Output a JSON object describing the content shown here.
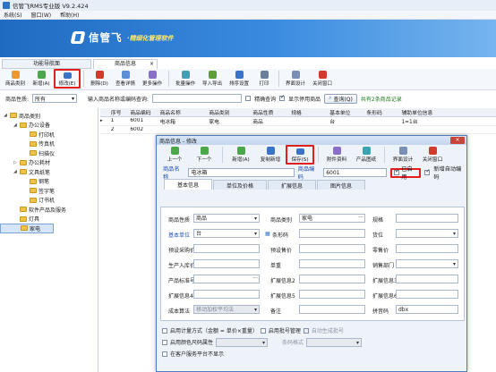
{
  "window": {
    "title": "信管飞RMS专业版 V9.2.424"
  },
  "menu": [
    "系统(S)",
    "窗口(W)",
    "帮助(H)"
  ],
  "banner": {
    "brand": "信管飞",
    "tagline": "·精细化管理软件"
  },
  "tabs": {
    "nav": "功能导航面",
    "doc": "商品信息",
    "doc_close": "×"
  },
  "toolbar": [
    {
      "label": "商品类别",
      "color": "#e99b2b"
    },
    {
      "label": "新增(A)",
      "color": "#4aa84a"
    },
    {
      "label": "修改(E)",
      "color": "#3a74c9"
    },
    {
      "label": "删除(D)",
      "color": "#d23a2a"
    },
    {
      "label": "查看详情",
      "color": "#5b8fd6"
    },
    {
      "label": "更多操作",
      "color": "#8a6fc8"
    },
    {
      "label": "批量操作",
      "color": "#3ca3b5"
    },
    {
      "label": "导入导出",
      "color": "#5e9d3a"
    },
    {
      "label": "排序设置",
      "color": "#3a74c9"
    },
    {
      "label": "打印",
      "color": "#6a7f99"
    },
    {
      "label": "界面设计",
      "color": "#7a8fb5"
    },
    {
      "label": "关闭窗口",
      "color": "#d23a2a"
    }
  ],
  "filter": {
    "prop_label": "商品性质:",
    "prop_value": "所有",
    "search_label": "输入商品名称或编码查询:",
    "exact_label": "精确查询",
    "show_disabled_label": "显示停用商品",
    "query_btn": "查询(Q)",
    "summary": "共有2条商品记录"
  },
  "tree": [
    {
      "label": "商品类别",
      "level": 0,
      "toggle": "◢"
    },
    {
      "label": "办公设备",
      "level": 1,
      "toggle": "◢"
    },
    {
      "label": "打印机",
      "level": 2,
      "toggle": ""
    },
    {
      "label": "传真机",
      "level": 2,
      "toggle": ""
    },
    {
      "label": "扫描仪",
      "level": 2,
      "toggle": ""
    },
    {
      "label": "办公耗材",
      "level": 1,
      "toggle": "▷"
    },
    {
      "label": "文具纸笔",
      "level": 1,
      "toggle": "◢"
    },
    {
      "label": "钢笔",
      "level": 2,
      "toggle": ""
    },
    {
      "label": "签字笔",
      "level": 2,
      "toggle": ""
    },
    {
      "label": "订书机",
      "level": 2,
      "toggle": ""
    },
    {
      "label": "软件产品及服务",
      "level": 1,
      "toggle": ""
    },
    {
      "label": "灯具",
      "level": 1,
      "toggle": ""
    },
    {
      "label": "家电",
      "level": 1,
      "toggle": "",
      "selected": true
    }
  ],
  "grid": {
    "headers": [
      "序号",
      "商品编码",
      "商品名称",
      "商品类别",
      "商品性质",
      "规格",
      "基本单位",
      "条形码",
      "辅助单位信息"
    ],
    "rows": [
      [
        "1",
        "6001",
        "电冰箱",
        "家电",
        "商品",
        "",
        "台",
        "",
        "1=1台"
      ],
      [
        "2",
        "6002",
        "",
        "",
        "",
        "",
        "",
        "",
        ""
      ]
    ]
  },
  "dialog": {
    "title": "商品信息 - 修改",
    "close": "×",
    "toolbar": [
      {
        "label": "上一个",
        "color": "#4aa84a"
      },
      {
        "label": "下一个",
        "color": "#4aa84a"
      },
      {
        "label": "新增(A)",
        "color": "#4aa84a"
      },
      {
        "label": "复制新增",
        "color": "#3a74c9"
      },
      {
        "label": "保存(S)",
        "color": "#3a74c9"
      },
      {
        "label": "附件资料",
        "color": "#8a6fc8"
      },
      {
        "label": "产品图纸",
        "color": "#3ca3b5"
      },
      {
        "label": "界面设计",
        "color": "#7a8fb5"
      },
      {
        "label": "关闭窗口",
        "color": "#d23a2a"
      }
    ],
    "name_label": "商品名称",
    "name_value": "电冰箱",
    "code_label": "商品编码",
    "code_value": "6001",
    "enabled_label": "已启用",
    "auto_code_label": "新增自动编码",
    "tabs": [
      "基本信息",
      "单位及价格",
      "扩展信息",
      "图片信息"
    ],
    "fields": {
      "prop_label": "商品性质",
      "prop_value": "商品",
      "cat_label": "商品类别",
      "cat_value": "家电",
      "spec_label": "规格",
      "unit_label": "基本单位",
      "unit_value": "台",
      "barcode_label": "条形码",
      "location_label": "货位",
      "pre_purchase_label": "预设采购价",
      "pre_sale_label": "预设售价",
      "retail_label": "零售价",
      "origin_label": "生产入库价",
      "unit_weight_label": "单重",
      "sales_dept_label": "销售部门",
      "std_label": "产品标准号",
      "ext2_label": "扩展信息2",
      "ext3_label": "扩展信息3",
      "ext4_label": "扩展信息4",
      "ext5_label": "扩展信息5",
      "ext6_label": "扩展信息6",
      "cost_label": "成本算法",
      "cost_value": "移动加权平均法",
      "remark_label": "备注",
      "pinyin_label": "拼音码",
      "pinyin_value": "dbx"
    },
    "bottom": {
      "meter_label": "启用计量方式（金额 = 单价×重量）",
      "batch_label": "启用批号管理",
      "auto_batch_label": "自动生成批号",
      "color_size_label": "启用颜色尺码属性",
      "barcode_fmt_label": "条码格式",
      "show_on_platform_label": "在客户服务平台不显示"
    }
  }
}
